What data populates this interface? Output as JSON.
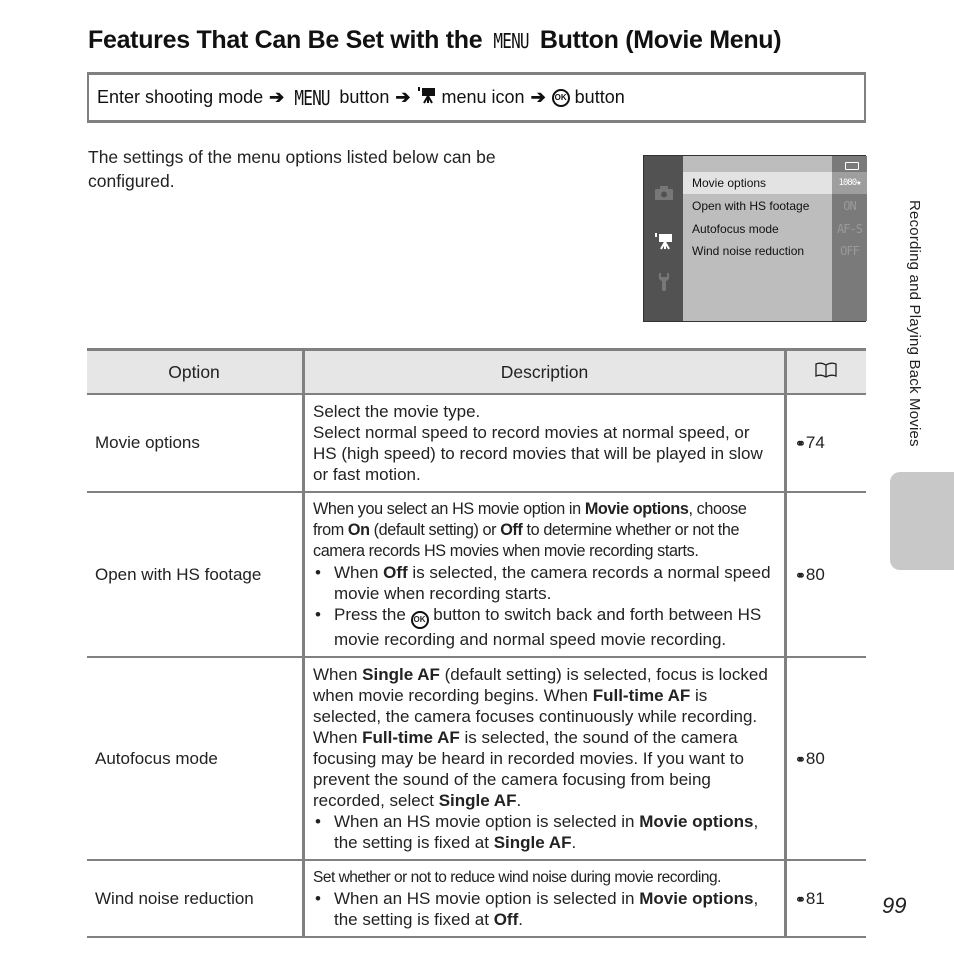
{
  "title": {
    "prefix": "Features That Can Be Set with the",
    "menu_glyph": "MENU",
    "suffix": "Button (Movie Menu)"
  },
  "nav_path": {
    "step1": "Enter shooting mode",
    "arrow": "➔",
    "menu_glyph": "MENU",
    "step2": "button",
    "step3": "menu icon",
    "ok_glyph": "OK",
    "step4": "button"
  },
  "intro": "The settings of the menu options listed below can be configured.",
  "camera_screen": {
    "items": [
      {
        "label": "Movie options",
        "value": "1080★",
        "selected": true
      },
      {
        "label": "Open with HS footage",
        "value": "ON",
        "selected": false
      },
      {
        "label": "Autofocus mode",
        "value": "AF-S",
        "selected": false
      },
      {
        "label": "Wind noise reduction",
        "value": "OFF",
        "selected": false
      }
    ],
    "side_icons": [
      "camera-icon",
      "movie-camera-icon",
      "wrench-icon"
    ],
    "active_side_icon": "movie-camera-icon"
  },
  "side_label": "Recording and Playing Back Movies",
  "table": {
    "headers": {
      "option": "Option",
      "description": "Description",
      "ref": "📖"
    },
    "rows": [
      {
        "option": "Movie options",
        "ref_icon": "⚯",
        "ref_page": "74"
      },
      {
        "option": "Open with HS footage",
        "ref_icon": "⚯",
        "ref_page": "80"
      },
      {
        "option": "Autofocus mode",
        "ref_icon": "⚯",
        "ref_page": "80"
      },
      {
        "option": "Wind noise reduction",
        "ref_icon": "⚯",
        "ref_page": "81"
      }
    ],
    "desc": {
      "r0_l1": "Select the movie type.",
      "r0_l2": "Select normal speed to record movies at normal speed, or HS (high speed) to record movies that will be played in slow or fast motion.",
      "r1_a": "When you select an HS movie option in ",
      "r1_b": "Movie options",
      "r1_c": ", choose from ",
      "r1_d": "On",
      "r1_e": " (default setting) or ",
      "r1_f": "Off",
      "r1_g": " to determine whether or not the camera records HS movies when movie recording starts.",
      "r1_b1a": "When ",
      "r1_b1b": "Off",
      "r1_b1c": " is selected, the camera records a normal speed movie when recording starts.",
      "r1_b2a": "Press the ",
      "r1_b2_ok": "OK",
      "r1_b2b": " button to switch back and forth between HS movie recording and normal speed movie recording.",
      "r2_a": "When ",
      "r2_b": "Single AF",
      "r2_c": " (default setting) is selected, focus is locked when movie recording begins. When ",
      "r2_d": "Full-time AF",
      "r2_e": " is selected, the camera focuses continuously while recording. When ",
      "r2_f": "Full-time AF",
      "r2_g": " is selected, the sound of the camera focusing may be heard in recorded movies. If you want to prevent the sound of the camera focusing from being recorded, select ",
      "r2_h": "Single AF",
      "r2_i": ".",
      "r2_b1a": "When an HS movie option is selected in ",
      "r2_b1b": "Movie options",
      "r2_b1c": ", the setting is fixed at ",
      "r2_b1d": "Single AF",
      "r2_b1e": ".",
      "r3_l1": "Set whether or not to reduce wind noise during movie recording.",
      "r3_b1a": "When an HS movie option is selected in ",
      "r3_b1b": "Movie options",
      "r3_b1c": ", the setting is fixed at ",
      "r3_b1d": "Off",
      "r3_b1e": "."
    },
    "bullet": "•"
  },
  "page_number": "99"
}
